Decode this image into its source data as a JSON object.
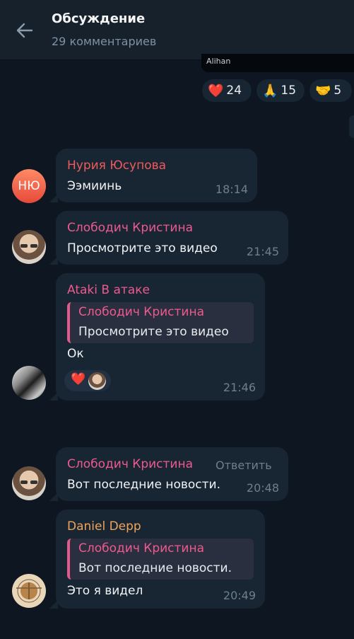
{
  "header": {
    "title": "Обсуждение",
    "subtitle": "29 комментариев"
  },
  "media": {
    "caption": "Alihan"
  },
  "reactions": [
    {
      "emoji": "❤️",
      "count": "24",
      "icon": "heart-icon"
    },
    {
      "emoji": "🙏",
      "count": "15",
      "icon": "folded-hands-icon"
    },
    {
      "emoji": "🤝",
      "count": "5",
      "icon": "handshake-icon"
    }
  ],
  "messages": [
    {
      "author": "Нурия Юсупова",
      "author_color": "#ef5b5b",
      "avatar_initials": "НЮ",
      "text": "Ээмиинь",
      "time": "18:14"
    },
    {
      "author": "Слободич Кристина",
      "author_color": "#ee5a8f",
      "text": "Просмотрите это видео",
      "time": "21:45"
    },
    {
      "author": "Ataki В атаке",
      "author_color": "#ee5a8f",
      "reply": {
        "author": "Слободич Кристина",
        "text": "Просмотрите это видео"
      },
      "text": "Ок",
      "time": "21:46",
      "reaction": "❤️"
    },
    {
      "author": "Слободич Кристина",
      "author_color": "#ee5a8f",
      "action": "Ответить",
      "text": "Вот последние новости.",
      "time": "20:48"
    },
    {
      "author": "Daniel Depp",
      "author_color": "#f0a35b",
      "reply": {
        "author": "Слободич Кристина",
        "text": "Вот последние новости."
      },
      "text": "Это я видел",
      "time": "20:49"
    }
  ]
}
